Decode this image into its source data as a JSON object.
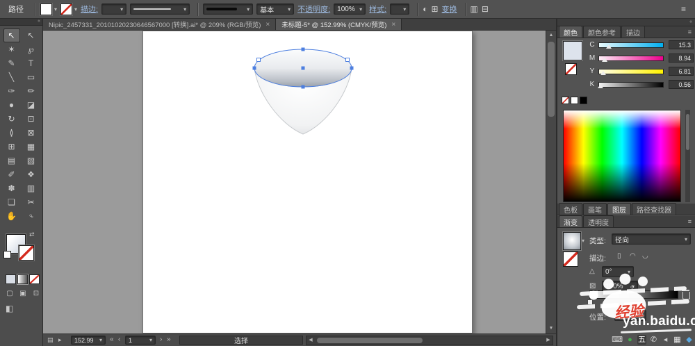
{
  "theme": {
    "bg": "#535353",
    "bg_dark": "#3f3f3f",
    "canvas": "#9b9b9b",
    "accent_link": "#9cb8dd",
    "selection_blue": "#4d7fe0",
    "watermark_red": "#e04030"
  },
  "control_bar": {
    "object_label": "路径",
    "stroke_label": "描边:",
    "brush_name": "基本",
    "opacity_label": "不透明度:",
    "opacity_value": "100%",
    "style_label": "样式:",
    "transform_label": "变换"
  },
  "tab_bar": {
    "tabs": [
      {
        "title": "Nipic_2457331_20101020230646567000 [转换].ai* @ 209% (RGB/预览)",
        "close": "×",
        "active": false
      },
      {
        "title": "未标题-5* @ 152.99% (CMYK/预览)",
        "close": "×",
        "active": true
      }
    ]
  },
  "toolbar": {
    "tools": [
      {
        "name": "selection-tool",
        "glyph": "↖",
        "active": true
      },
      {
        "name": "direct-selection-tool",
        "glyph": "↖"
      },
      {
        "name": "magic-wand-tool",
        "glyph": "✶"
      },
      {
        "name": "lasso-tool",
        "glyph": "℘"
      },
      {
        "name": "pen-tool",
        "glyph": "✎"
      },
      {
        "name": "type-tool",
        "glyph": "T"
      },
      {
        "name": "line-segment-tool",
        "glyph": "╲"
      },
      {
        "name": "rectangle-tool",
        "glyph": "▭"
      },
      {
        "name": "paintbrush-tool",
        "glyph": "✑"
      },
      {
        "name": "pencil-tool",
        "glyph": "✏"
      },
      {
        "name": "blob-brush-tool",
        "glyph": "●"
      },
      {
        "name": "eraser-tool",
        "glyph": "◪"
      },
      {
        "name": "rotate-tool",
        "glyph": "↻"
      },
      {
        "name": "scale-tool",
        "glyph": "⊡"
      },
      {
        "name": "width-tool",
        "glyph": "≬"
      },
      {
        "name": "free-transform-tool",
        "glyph": "⊠"
      },
      {
        "name": "shape-builder-tool",
        "glyph": "⊞"
      },
      {
        "name": "perspective-grid-tool",
        "glyph": "▦"
      },
      {
        "name": "mesh-tool",
        "glyph": "▤"
      },
      {
        "name": "gradient-tool",
        "glyph": "▧"
      },
      {
        "name": "eyedropper-tool",
        "glyph": "✐"
      },
      {
        "name": "blend-tool",
        "glyph": "❖"
      },
      {
        "name": "symbol-sprayer-tool",
        "glyph": "✽"
      },
      {
        "name": "column-graph-tool",
        "glyph": "▥"
      },
      {
        "name": "artboard-tool",
        "glyph": "❏"
      },
      {
        "name": "slice-tool",
        "glyph": "✂"
      },
      {
        "name": "hand-tool",
        "glyph": "✋"
      },
      {
        "name": "zoom-tool",
        "glyph": "♀",
        "rotate": true
      }
    ],
    "mode_buttons": [
      {
        "name": "draw-normal-mode",
        "glyph": "▢"
      },
      {
        "name": "draw-behind-mode",
        "glyph": "▣"
      },
      {
        "name": "draw-inside-mode",
        "glyph": "⊡"
      }
    ],
    "screen_mode_glyph": "◧"
  },
  "color_panel": {
    "tabs": [
      {
        "id": "color",
        "label": "颜色",
        "active": true
      },
      {
        "id": "color-guide",
        "label": "颜色参考",
        "active": false
      },
      {
        "id": "stroke",
        "label": "描边",
        "active": false
      }
    ],
    "swatch_color": "#dde3ec",
    "sliders": [
      {
        "label": "C",
        "value": "15.3",
        "track_from": "#eafafd",
        "track_to": "#00aeef",
        "pos": 15
      },
      {
        "label": "M",
        "value": "8.94",
        "track_from": "#feeef7",
        "track_to": "#ec008c",
        "pos": 9
      },
      {
        "label": "Y",
        "value": "6.81",
        "track_from": "#fffde9",
        "track_to": "#fff200",
        "pos": 7
      },
      {
        "label": "K",
        "value": "0.56",
        "track_from": "#f2f2f2",
        "track_to": "#000000",
        "pos": 2
      }
    ]
  },
  "middle_tabs": [
    {
      "id": "swatches",
      "label": "色板",
      "active": false
    },
    {
      "id": "brushes",
      "label": "画笔",
      "active": false
    },
    {
      "id": "layers",
      "label": "图层",
      "active": true
    },
    {
      "id": "pathfinder",
      "label": "路径查找器",
      "active": false
    }
  ],
  "gradient_tabs": [
    {
      "id": "gradient",
      "label": "渐变",
      "active": true
    },
    {
      "id": "transparency",
      "label": "透明度",
      "active": false
    }
  ],
  "gradient_panel": {
    "type_label": "类型:",
    "type_value": "径向",
    "stroke_label": "描边:",
    "angle_value": "0°",
    "opacity_value": "100%",
    "location_label": "位置:"
  },
  "status_bar": {
    "zoom_value": "152.99",
    "artboard_value": "1",
    "status_text": "选择"
  },
  "watermark": {
    "badge_text": "经验",
    "site_text": "yan.baidu.com"
  },
  "tray": {
    "icons": [
      {
        "name": "keyboard-tray-icon",
        "glyph": "⌨",
        "color": "#d8d8d8"
      },
      {
        "name": "green-app-tray-icon",
        "glyph": "●",
        "color": "#45b04d"
      },
      {
        "name": "wubi-ime-tray-icon",
        "glyph": "五",
        "color": "#ffffff",
        "bg": "#3c3c3c"
      },
      {
        "name": "phone-tray-icon",
        "glyph": "✆",
        "color": "#e6e6e6"
      },
      {
        "name": "collapse-tray-icon",
        "glyph": "◂",
        "color": "#cccccc"
      },
      {
        "name": "calendar-tray-icon",
        "glyph": "▦",
        "color": "#e6e6e6"
      },
      {
        "name": "chat-tray-icon",
        "glyph": "◆",
        "color": "#5aa8e0"
      }
    ]
  },
  "icons": {
    "dropdown": "▾",
    "panel_menu": "≡",
    "collapse": "«",
    "recolor_artwork": "◐",
    "align": "⊞",
    "arrange": "▥",
    "workspace": "⊟",
    "swap": "⇄",
    "angle": "△",
    "opacity": "▨",
    "midpoint": "◇",
    "scroll_up": "▲",
    "scroll_down": "▼",
    "scroll_left": "◀",
    "scroll_right": "▶",
    "nav_first": "«",
    "nav_prev": "‹",
    "nav_next": "›",
    "nav_last": "»",
    "stroke_icon_1": "▯",
    "stroke_icon_2": "◠",
    "stroke_icon_3": "◡",
    "status_doc": "▤",
    "status_menu": "▸"
  }
}
